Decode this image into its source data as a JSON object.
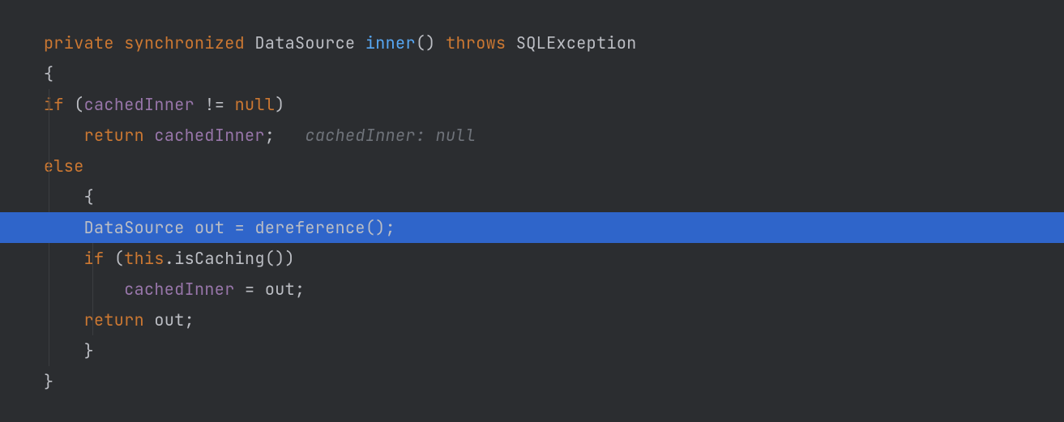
{
  "code": {
    "kw_private": "private",
    "kw_synchronized": "synchronized",
    "type_datasource": "DataSource",
    "method_name": "inner",
    "parens_empty": "()",
    "kw_throws": "throws",
    "type_sqlexception": "SQLException",
    "brace_open": "{",
    "brace_close": "}",
    "kw_if": "if",
    "paren_open": "(",
    "paren_close": ")",
    "field_cachedinner": "cachedInner",
    "op_ne": "!=",
    "kw_null": "null",
    "kw_return": "return",
    "semi": ";",
    "inlay_hint": "cachedInner: null",
    "kw_else": "else",
    "local_out": "out",
    "op_assign": "=",
    "call_dereference": "dereference",
    "kw_this": "this",
    "dot": ".",
    "call_iscaching": "isCaching"
  }
}
